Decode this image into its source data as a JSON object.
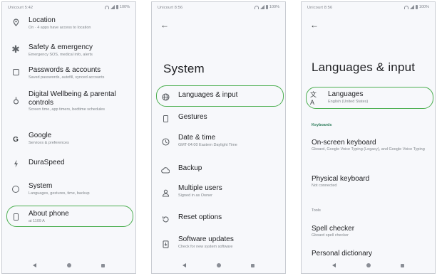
{
  "status": {
    "p1_time": "Unicourt 5:42",
    "p2_time": "Unicourt 8:56",
    "p3_time": "Unicourt 8:56",
    "battery": "100%"
  },
  "phone1": {
    "items": [
      {
        "title": "Location",
        "subtitle": "On · 4 apps have access to location",
        "icon": "location-pin-icon"
      },
      {
        "title": "Safety & emergency",
        "subtitle": "Emergency SOS, medical info, alerts",
        "icon": "asterisk-icon"
      },
      {
        "title": "Passwords & accounts",
        "subtitle": "Saved passwords, autofill, synced accounts",
        "icon": "account-box-icon"
      },
      {
        "title": "Digital Wellbeing & parental controls",
        "subtitle": "Screen time, app timers, bedtime schedules",
        "icon": "wellbeing-icon"
      },
      {
        "title": "Google",
        "subtitle": "Services & preferences",
        "icon": "google-icon"
      },
      {
        "title": "DuraSpeed",
        "subtitle": "",
        "icon": "duraspeed-icon"
      },
      {
        "title": "System",
        "subtitle": "Languages, gestures, time, backup",
        "icon": "info-icon"
      },
      {
        "title": "About phone",
        "subtitle": "at 1109 A",
        "icon": "phone-icon"
      }
    ]
  },
  "phone2": {
    "page_title": "System",
    "items": [
      {
        "title": "Languages & input",
        "subtitle": "",
        "icon": "globe-icon"
      },
      {
        "title": "Gestures",
        "subtitle": "",
        "icon": "gestures-icon"
      },
      {
        "title": "Date & time",
        "subtitle": "GMT-04:00 Eastern Daylight Time",
        "icon": "clock-icon"
      },
      {
        "title": "Backup",
        "subtitle": "",
        "icon": "cloud-icon"
      },
      {
        "title": "Multiple users",
        "subtitle": "Signed in as Owner",
        "icon": "users-icon"
      },
      {
        "title": "Reset options",
        "subtitle": "",
        "icon": "reset-icon"
      },
      {
        "title": "Software updates",
        "subtitle": "Check for new system software",
        "icon": "update-icon"
      }
    ]
  },
  "phone3": {
    "page_title": "Languages & input",
    "languages": {
      "title": "Languages",
      "subtitle": "English (United States)"
    },
    "keyboards_header": "Keyboards",
    "onscreen": {
      "title": "On-screen keyboard",
      "subtitle": "Gboard, Google Voice Typing (Legacy), and Google Voice Typing"
    },
    "physical": {
      "title": "Physical keyboard",
      "subtitle": "Not connected"
    },
    "tools_header": "Tools",
    "spell": {
      "title": "Spell checker",
      "subtitle": "Gboard spell checker"
    },
    "personal": {
      "title": "Personal dictionary"
    }
  },
  "icons": {
    "back_arrow": "arrow-back-icon"
  },
  "colors": {
    "highlight": "#4caf50",
    "section_header": "#2e7d5b"
  }
}
